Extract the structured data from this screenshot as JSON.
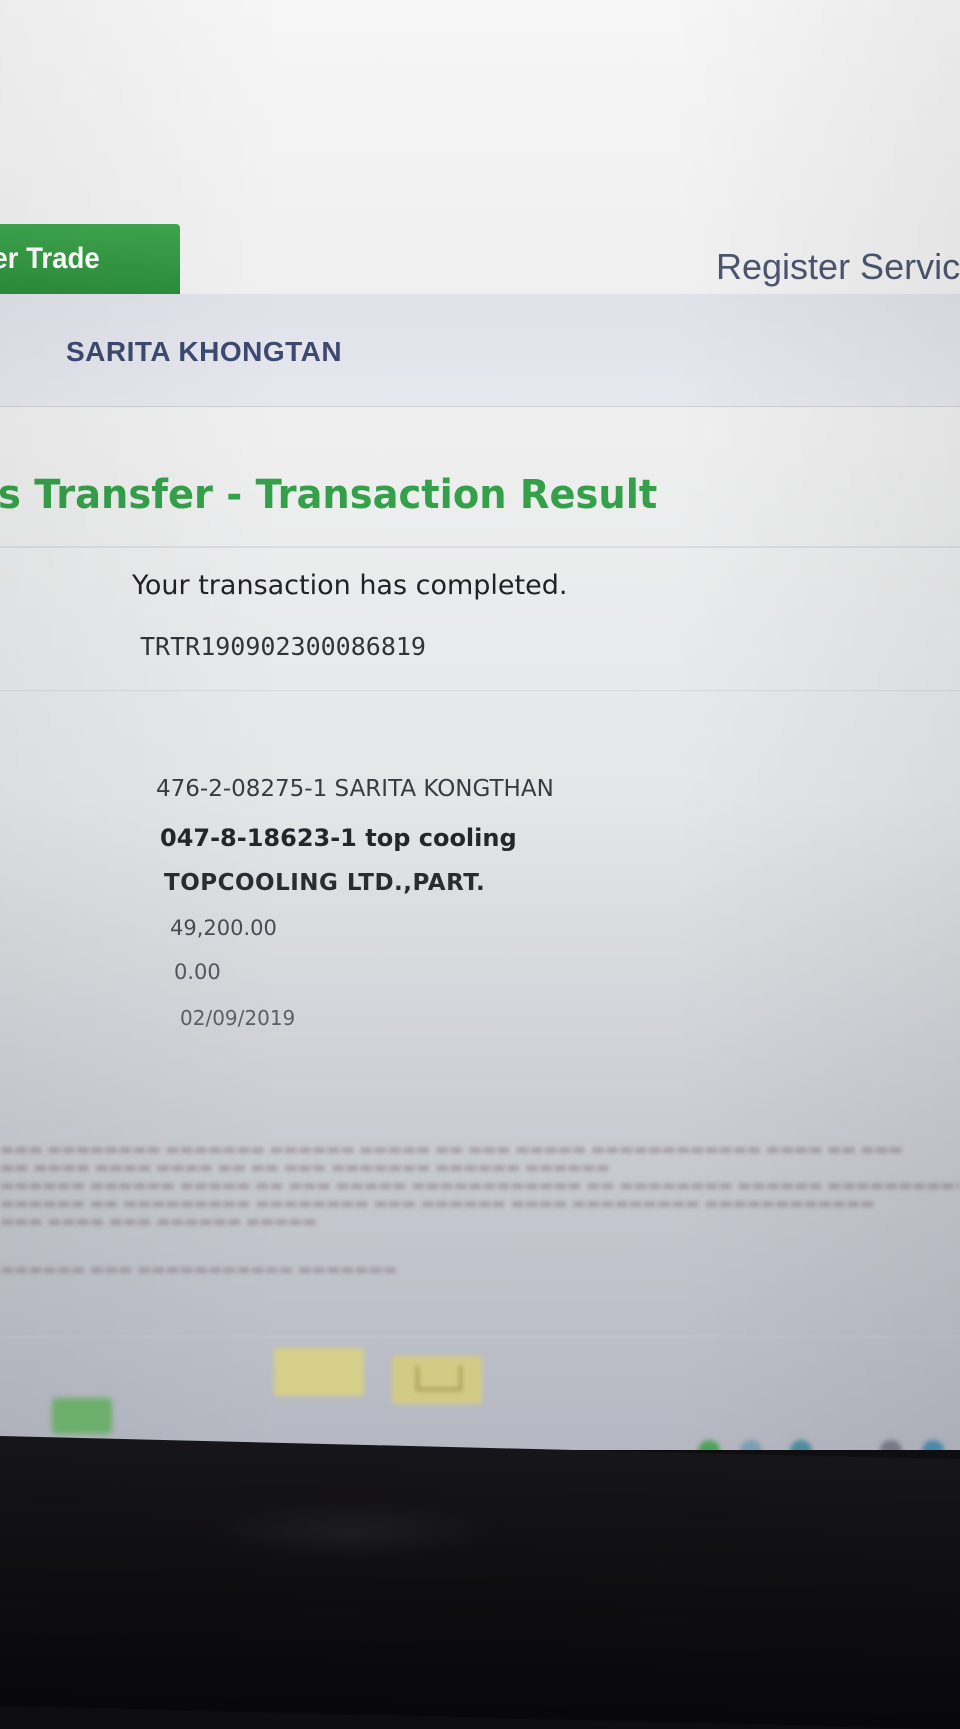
{
  "nav": {
    "active_tab_label": "er Trade",
    "register_label": "Register Servic"
  },
  "user": {
    "name": "SARITA KHONGTAN"
  },
  "page": {
    "title": "s Transfer - Transaction Result"
  },
  "result": {
    "message": "Your transaction has completed.",
    "reference": "TRTR190902300086819"
  },
  "transfer": {
    "from_account": "476-2-08275-1 SARITA KONGTHAN",
    "to_account": "047-8-18623-1 top cooling",
    "beneficiary_name": "TOPCOOLING LTD.,PART.",
    "amount": "49,200.00",
    "fee": "0.00",
    "date": "02/09/2019"
  },
  "colors": {
    "accent_green": "#35a04a",
    "tab_green": "#2b8d3a",
    "user_name": "#3b4a6e"
  }
}
